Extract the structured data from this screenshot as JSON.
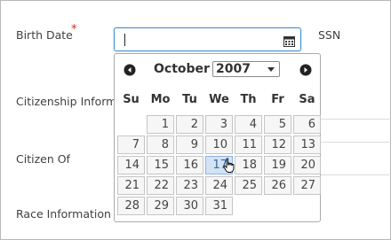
{
  "form": {
    "birth_date_label": "Birth Date",
    "required_marker": "*",
    "ssn_label": "SSN",
    "citizenship_label": "Citizenship Inform",
    "citizen_of_label": "Citizen Of",
    "race_label": "Race Information",
    "birth_date_value": ""
  },
  "datepicker": {
    "month": "October",
    "year": "2007",
    "weekdays": [
      "Su",
      "Mo",
      "Tu",
      "We",
      "Th",
      "Fr",
      "Sa"
    ],
    "weeks": [
      [
        "",
        "1",
        "2",
        "3",
        "4",
        "5",
        "6"
      ],
      [
        "7",
        "8",
        "9",
        "10",
        "11",
        "12",
        "13"
      ],
      [
        "14",
        "15",
        "16",
        "17",
        "18",
        "19",
        "20"
      ],
      [
        "21",
        "22",
        "23",
        "24",
        "25",
        "26",
        "27"
      ],
      [
        "28",
        "29",
        "30",
        "31",
        "",
        "",
        ""
      ]
    ],
    "hovered_day": "17",
    "prev_icon": "chevron-left-icon",
    "next_icon": "chevron-right-icon"
  },
  "colors": {
    "accent": "#3e8ed0",
    "required": "#d9261c",
    "selected_day_bg": "#d4e3f4"
  }
}
